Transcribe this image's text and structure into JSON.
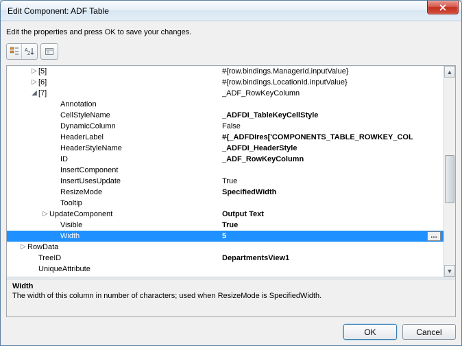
{
  "window": {
    "title": "Edit Component: ADF Table"
  },
  "instruction": "Edit the properties and press OK to save your changes.",
  "grid": {
    "rows": [
      {
        "depth": 2,
        "exp": "collapsed",
        "label": "[5]",
        "value": "#{row.bindings.ManagerId.inputValue}",
        "bold": false
      },
      {
        "depth": 2,
        "exp": "collapsed",
        "label": "[6]",
        "value": "#{row.bindings.LocationId.inputValue}",
        "bold": false
      },
      {
        "depth": 2,
        "exp": "expanded",
        "label": "[7]",
        "value": "_ADF_RowKeyColumn",
        "bold": false
      },
      {
        "depth": 4,
        "exp": "none",
        "label": "Annotation",
        "value": "",
        "bold": false
      },
      {
        "depth": 4,
        "exp": "none",
        "label": "CellStyleName",
        "value": "_ADFDI_TableKeyCellStyle",
        "bold": true
      },
      {
        "depth": 4,
        "exp": "none",
        "label": "DynamicColumn",
        "value": "False",
        "bold": false
      },
      {
        "depth": 4,
        "exp": "none",
        "label": "HeaderLabel",
        "value": "#{_ADFDIres['COMPONENTS_TABLE_ROWKEY_COL",
        "bold": true
      },
      {
        "depth": 4,
        "exp": "none",
        "label": "HeaderStyleName",
        "value": "_ADFDI_HeaderStyle",
        "bold": true
      },
      {
        "depth": 4,
        "exp": "none",
        "label": "ID",
        "value": "_ADF_RowKeyColumn",
        "bold": true
      },
      {
        "depth": 4,
        "exp": "none",
        "label": "InsertComponent",
        "value": "",
        "bold": false
      },
      {
        "depth": 4,
        "exp": "none",
        "label": "InsertUsesUpdate",
        "value": "True",
        "bold": false
      },
      {
        "depth": 4,
        "exp": "none",
        "label": "ResizeMode",
        "value": "SpecifiedWidth",
        "bold": true
      },
      {
        "depth": 4,
        "exp": "none",
        "label": "Tooltip",
        "value": "",
        "bold": false
      },
      {
        "depth": 3,
        "exp": "collapsed",
        "label": "UpdateComponent",
        "value": "Output Text",
        "bold": true
      },
      {
        "depth": 4,
        "exp": "none",
        "label": "Visible",
        "value": "True",
        "bold": true
      },
      {
        "depth": 4,
        "exp": "none",
        "label": "Width",
        "value": "5",
        "bold": true,
        "selected": true,
        "ellipsis": true
      },
      {
        "depth": 1,
        "exp": "collapsed",
        "label": "RowData",
        "value": "",
        "bold": false
      },
      {
        "depth": 2,
        "exp": "none",
        "label": "TreeID",
        "value": "DepartmentsView1",
        "bold": true
      },
      {
        "depth": 2,
        "exp": "none",
        "label": "UniqueAttribute",
        "value": "",
        "bold": false
      }
    ]
  },
  "description": {
    "title": "Width",
    "body": "The width of this column in number of characters; used when ResizeMode is SpecifiedWidth."
  },
  "buttons": {
    "ok": "OK",
    "cancel": "Cancel"
  }
}
